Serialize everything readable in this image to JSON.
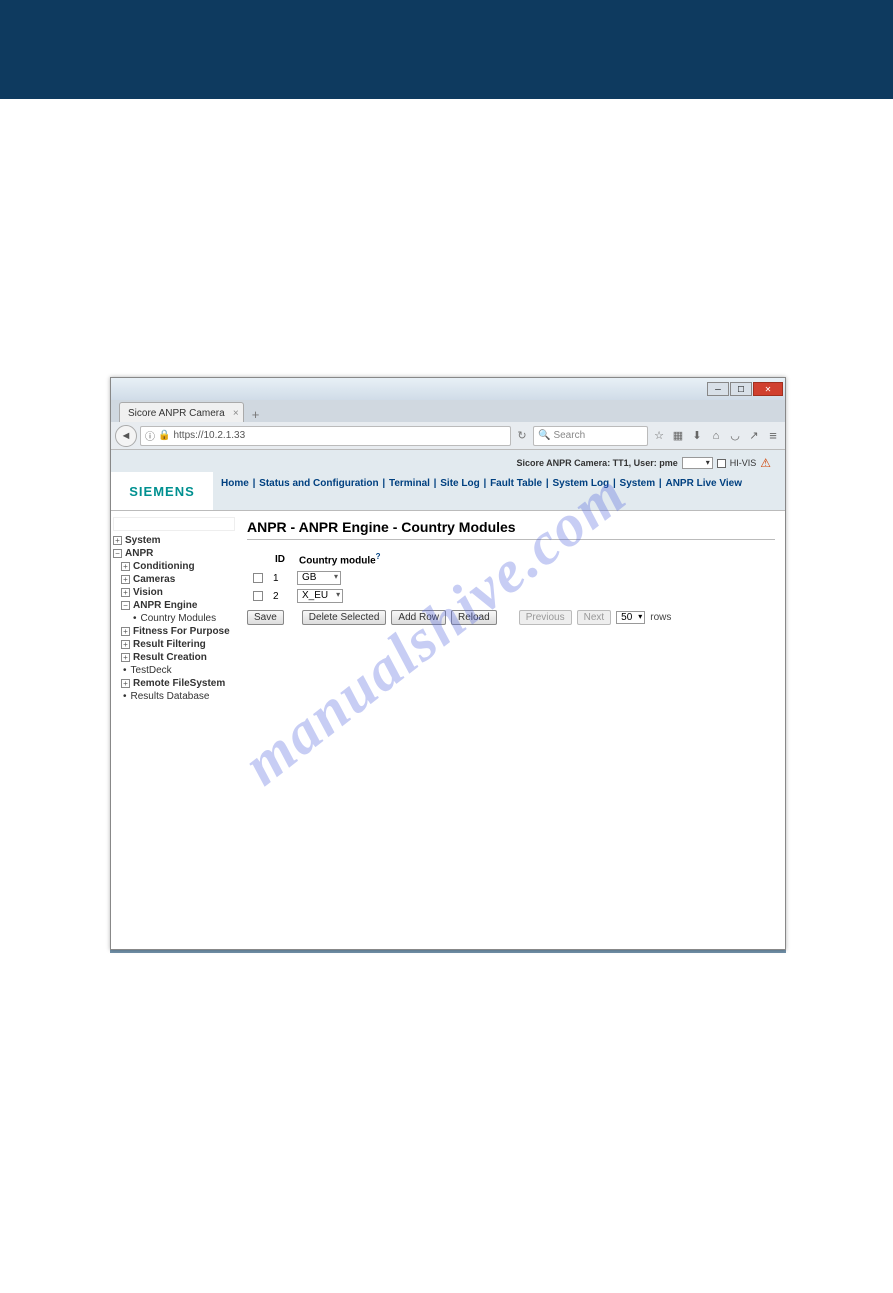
{
  "browser": {
    "tab_title": "Sicore ANPR Camera",
    "url": "https://10.2.1.33",
    "search_placeholder": "Search"
  },
  "header": {
    "status_text": "Sicore ANPR Camera: TT1, User: pme",
    "hivis_label": "HI-VIS",
    "logo": "SIEMENS",
    "nav": [
      "Home",
      "Status and Configuration",
      "Terminal",
      "Site Log",
      "Fault Table",
      "System Log",
      "System",
      "ANPR Live View"
    ]
  },
  "sidebar": {
    "nodes": [
      {
        "exp": "+",
        "label": "System",
        "bold": true,
        "indent": 0
      },
      {
        "exp": "−",
        "label": "ANPR",
        "bold": true,
        "indent": 0
      },
      {
        "exp": "+",
        "label": "Conditioning",
        "bold": true,
        "indent": 1
      },
      {
        "exp": "+",
        "label": "Cameras",
        "bold": true,
        "indent": 1
      },
      {
        "exp": "+",
        "label": "Vision",
        "bold": true,
        "indent": 1
      },
      {
        "exp": "−",
        "label": "ANPR Engine",
        "bold": true,
        "indent": 1
      },
      {
        "exp": "•",
        "label": "Country Modules",
        "bold": false,
        "indent": 2
      },
      {
        "exp": "+",
        "label": "Fitness For Purpose",
        "bold": true,
        "indent": 1
      },
      {
        "exp": "+",
        "label": "Result Filtering",
        "bold": true,
        "indent": 1
      },
      {
        "exp": "+",
        "label": "Result Creation",
        "bold": true,
        "indent": 1
      },
      {
        "exp": "•",
        "label": "TestDeck",
        "bold": false,
        "indent": 1
      },
      {
        "exp": "+",
        "label": "Remote FileSystem",
        "bold": true,
        "indent": 1
      },
      {
        "exp": "•",
        "label": "Results Database",
        "bold": false,
        "indent": 1
      }
    ]
  },
  "content": {
    "title": "ANPR - ANPR Engine - Country Modules",
    "table": {
      "col_id": "ID",
      "col_module": "Country module",
      "rows": [
        {
          "id": "1",
          "module": "GB"
        },
        {
          "id": "2",
          "module": "X_EU"
        }
      ]
    },
    "buttons": {
      "save": "Save",
      "delete": "Delete Selected",
      "add": "Add Row",
      "reload": "Reload",
      "prev": "Previous",
      "next": "Next",
      "rows_val": "50",
      "rows_label": "rows"
    }
  },
  "watermark": "manualshive.com"
}
